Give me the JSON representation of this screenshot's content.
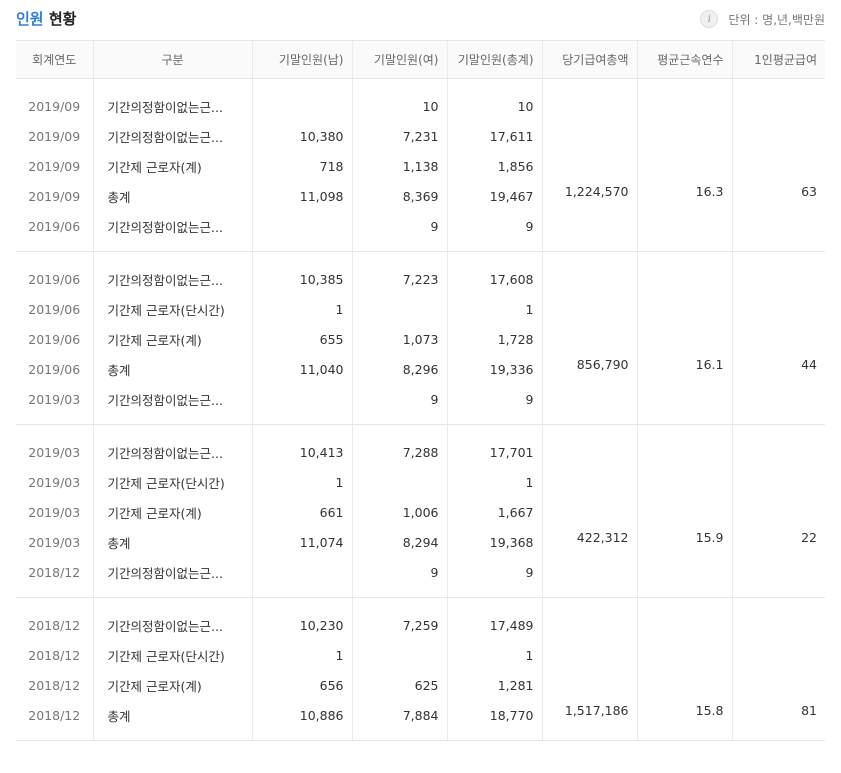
{
  "header": {
    "title_highlight": "인원",
    "title_rest": "현황",
    "unit_label": "단위 : 명,년,백만원",
    "info_icon": "info-icon"
  },
  "columns": [
    "회계연도",
    "구분",
    "기말인원(남)",
    "기말인원(여)",
    "기말인원(총계)",
    "당기급여총액",
    "평균근속연수",
    "1인평균급여"
  ],
  "groups": [
    {
      "rows": [
        {
          "date": "2019/09",
          "cat": "기간의정함이없는근...",
          "male": "",
          "female": "10",
          "total": "10"
        },
        {
          "date": "2019/09",
          "cat": "기간의정함이없는근...",
          "male": "10,380",
          "female": "7,231",
          "total": "17,611"
        },
        {
          "date": "2019/09",
          "cat": "기간제 근로자(계)",
          "male": "718",
          "female": "1,138",
          "total": "1,856"
        },
        {
          "date": "2019/09",
          "cat": "총계",
          "male": "11,098",
          "female": "8,369",
          "total": "19,467"
        },
        {
          "date": "2019/06",
          "cat": "기간의정함이없는근...",
          "male": "",
          "female": "9",
          "total": "9"
        }
      ],
      "salary_total": "1,224,570",
      "avg_tenure": "16.3",
      "avg_salary": "63"
    },
    {
      "rows": [
        {
          "date": "2019/06",
          "cat": "기간의정함이없는근...",
          "male": "10,385",
          "female": "7,223",
          "total": "17,608"
        },
        {
          "date": "2019/06",
          "cat": "기간제 근로자(단시간)",
          "male": "1",
          "female": "",
          "total": "1"
        },
        {
          "date": "2019/06",
          "cat": "기간제 근로자(계)",
          "male": "655",
          "female": "1,073",
          "total": "1,728"
        },
        {
          "date": "2019/06",
          "cat": "총계",
          "male": "11,040",
          "female": "8,296",
          "total": "19,336"
        },
        {
          "date": "2019/03",
          "cat": "기간의정함이없는근...",
          "male": "",
          "female": "9",
          "total": "9"
        }
      ],
      "salary_total": "856,790",
      "avg_tenure": "16.1",
      "avg_salary": "44"
    },
    {
      "rows": [
        {
          "date": "2019/03",
          "cat": "기간의정함이없는근...",
          "male": "10,413",
          "female": "7,288",
          "total": "17,701"
        },
        {
          "date": "2019/03",
          "cat": "기간제 근로자(단시간)",
          "male": "1",
          "female": "",
          "total": "1"
        },
        {
          "date": "2019/03",
          "cat": "기간제 근로자(계)",
          "male": "661",
          "female": "1,006",
          "total": "1,667"
        },
        {
          "date": "2019/03",
          "cat": "총계",
          "male": "11,074",
          "female": "8,294",
          "total": "19,368"
        },
        {
          "date": "2018/12",
          "cat": "기간의정함이없는근...",
          "male": "",
          "female": "9",
          "total": "9"
        }
      ],
      "salary_total": "422,312",
      "avg_tenure": "15.9",
      "avg_salary": "22"
    },
    {
      "rows": [
        {
          "date": "2018/12",
          "cat": "기간의정함이없는근...",
          "male": "10,230",
          "female": "7,259",
          "total": "17,489"
        },
        {
          "date": "2018/12",
          "cat": "기간제 근로자(단시간)",
          "male": "1",
          "female": "",
          "total": "1"
        },
        {
          "date": "2018/12",
          "cat": "기간제 근로자(계)",
          "male": "656",
          "female": "625",
          "total": "1,281"
        },
        {
          "date": "2018/12",
          "cat": "총계",
          "male": "10,886",
          "female": "7,884",
          "total": "18,770"
        }
      ],
      "salary_total": "1,517,186",
      "avg_tenure": "15.8",
      "avg_salary": "81"
    }
  ]
}
